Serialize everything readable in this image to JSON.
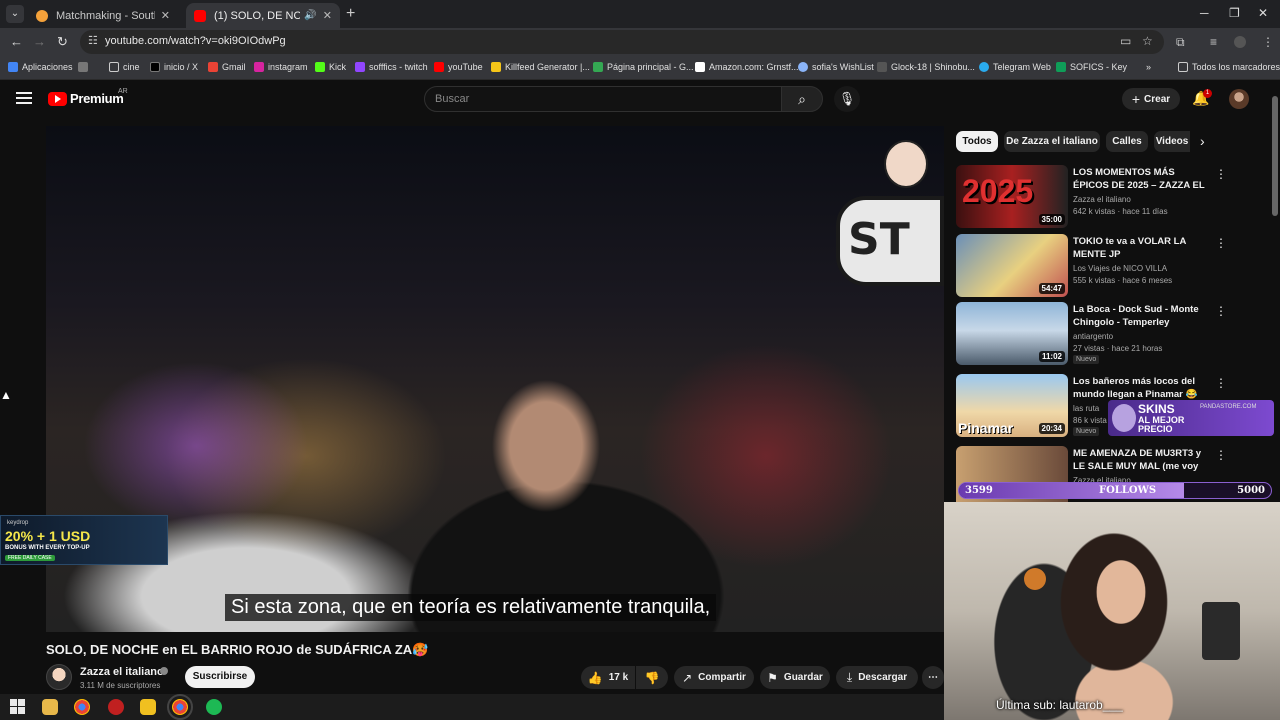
{
  "browser": {
    "tabs": [
      {
        "title": "Matchmaking - South America"
      },
      {
        "title": "(1) SOLO, DE NOCHE en EL"
      }
    ],
    "url": "youtube.com/watch?v=oki9OIOdwPg",
    "bookmarks": [
      "Aplicaciones",
      "cine",
      "inicio / X",
      "Gmail",
      "instagram",
      "Kick",
      "sofffics - twitch",
      "youTube",
      "Killfeed Generator |...",
      "Página principal - G...",
      "Amazon.com: Grnstf...",
      "sofia's WishList",
      "Glock-18 | Shinobu...",
      "Telegram Web",
      "SOFICS - Key"
    ],
    "bookmarks_all": "Todos los marcadores"
  },
  "yt": {
    "brand": "Premium",
    "region": "AR",
    "search_placeholder": "Buscar",
    "create_label": "Crear",
    "notif_count": "1"
  },
  "video": {
    "subtitle": "Si esta zona, que en teoría es relativamente tranquila,",
    "title": "SOLO, DE NOCHE en EL BARRIO ROJO de SUDÁFRICA ZA🥵",
    "overlay_logo": "ST",
    "channel": "Zazza el italiano",
    "subs": "3.11 M de suscriptores",
    "subscribe_label": "Suscribirse",
    "likes": "17 k",
    "share_label": "Compartir",
    "save_label": "Guardar",
    "download_label": "Descargar"
  },
  "keydrop": {
    "brand": "keydrop",
    "promo": "20% + 1 USD",
    "sub": "BONUS WITH EVERY TOP-UP",
    "case": "FREE DAILY CASE"
  },
  "chips": [
    "Todos",
    "De Zazza el italiano",
    "Calles",
    "Videos"
  ],
  "recommendations": [
    {
      "title": "LOS MOMENTOS MÁS ÉPICOS DE 2025 – ZAZZA EL ITALIAN...",
      "channel": "Zazza el italiano",
      "stats": "642 k vistas · hace 11 días",
      "duration": "35:00",
      "badge": ""
    },
    {
      "title": "TOKIO te va a VOLAR LA MENTE JP",
      "channel": "Los Viajes de NICO VILLA",
      "stats": "555 k vistas · hace 6 meses",
      "duration": "54:47",
      "badge": ""
    },
    {
      "title": "La Boca - Dock Sud - Monte Chingolo - Temperley",
      "channel": "antiargento",
      "stats": "27 vistas · hace 21 horas",
      "duration": "11:02",
      "badge": "Nuevo"
    },
    {
      "title": "Los bañeros más locos del mundo llegan a Pinamar 😂",
      "channel": "las ruta",
      "stats": "86 k vista",
      "duration": "20:34",
      "badge": "Nuevo"
    },
    {
      "title": "ME AMENAZA DE MU3RT3 y LE SALE MUY MAL (me voy de all...",
      "channel": "Zazza el italiano",
      "stats": "",
      "duration": "",
      "badge": ""
    }
  ],
  "rec_thumb_texts": {
    "r1": "2025",
    "r4": "Pinamar"
  },
  "stream": {
    "skins_line1": "SKINS",
    "skins_line2": "AL MEJOR",
    "skins_line3": "PRECIO",
    "skins_site": "PANDASTORE.COM",
    "follows_current": "3599",
    "follows_label": "FOLLOWS",
    "follows_goal": "5000",
    "follows_progress_pct": 72,
    "last_sub": "Última sub: lautarob___"
  }
}
